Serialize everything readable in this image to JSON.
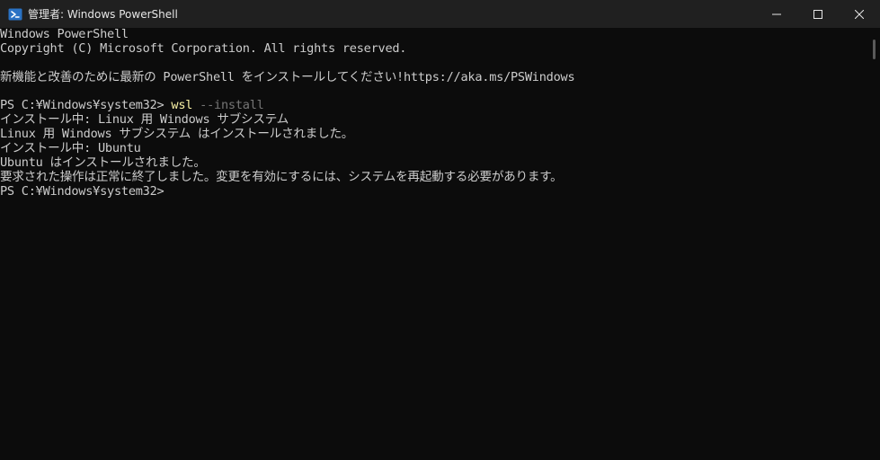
{
  "window": {
    "title": "管理者: Windows PowerShell",
    "app_icon": "powershell-icon",
    "buttons": {
      "minimize_icon": "minimize-icon",
      "maximize_icon": "maximize-icon",
      "close_icon": "close-icon"
    }
  },
  "colors": {
    "background": "#0c0c0c",
    "titlebar": "#202020",
    "text": "#cccccc",
    "command": "#f9f1a5",
    "parameter": "#767676"
  },
  "console": {
    "lines": [
      "Windows PowerShell",
      "Copyright (C) Microsoft Corporation. All rights reserved.",
      "",
      "新機能と改善のために最新の PowerShell をインストールしてください!https://aka.ms/PSWindows",
      "",
      "",
      "インストール中: Linux 用 Windows サブシステム",
      "Linux 用 Windows サブシステム はインストールされました。",
      "インストール中: Ubuntu",
      "Ubuntu はインストールされました。",
      "要求された操作は正常に終了しました。変更を有効にするには、システムを再起動する必要があります。",
      "PS C:¥Windows¥system32>"
    ],
    "command_line": {
      "prompt": "PS C:¥Windows¥system32> ",
      "command": "wsl",
      "parameter": " --install"
    }
  }
}
